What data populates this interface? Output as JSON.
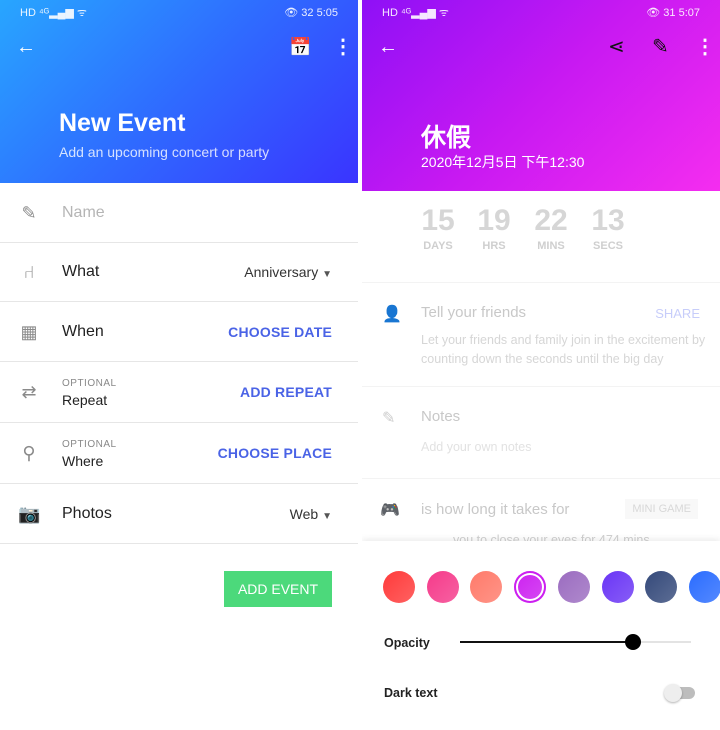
{
  "left": {
    "status": {
      "time": "5:05",
      "battery": "32"
    },
    "title": "New Event",
    "subtitle": "Add an upcoming concert or party",
    "rows": [
      {
        "label": "Name",
        "placeholder": true
      },
      {
        "label": "What",
        "value": "Anniversary"
      },
      {
        "label": "When",
        "action": "CHOOSE DATE"
      },
      {
        "optional": "OPTIONAL",
        "label": "Repeat",
        "action": "ADD REPEAT"
      },
      {
        "optional": "OPTIONAL",
        "label": "Where",
        "action": "CHOOSE PLACE"
      },
      {
        "label": "Photos",
        "value": "Web"
      }
    ],
    "add_button": "ADD EVENT",
    "header_colors": [
      "#28a6ff",
      "#3a34ff"
    ]
  },
  "right": {
    "status": {
      "time": "5:07",
      "battery": "31"
    },
    "title": "休假",
    "datetime": "2020年12月5日 下午12:30",
    "countdown": [
      {
        "n": "15",
        "u": "DAYS"
      },
      {
        "n": "19",
        "u": "HRS"
      },
      {
        "n": "22",
        "u": "MINS"
      },
      {
        "n": "13",
        "u": "SECS"
      }
    ],
    "friends": {
      "title": "Tell your friends",
      "action": "SHARE",
      "text": "Let your friends and family join in the excitement by counting down the seconds until the big day"
    },
    "notes": {
      "title": "Notes",
      "placeholder": "Add your own notes"
    },
    "game": {
      "title": "is how long it takes for",
      "action": "MINI GAME",
      "text": "you to close your eyes for 474 mins"
    },
    "colors": [
      "#ff3a3a",
      "#f53a8a",
      "#ff7a6a",
      "#cc1ff0",
      "#9b6cc0",
      "#6a35f5",
      "#34497a",
      "#2a6cff"
    ],
    "selected_color_index": 3,
    "opacity_label": "Opacity",
    "opacity_value": 0.75,
    "dark_text_label": "Dark text",
    "dark_text_on": false,
    "header_colors": [
      "#8e10f6",
      "#f52df0"
    ]
  }
}
